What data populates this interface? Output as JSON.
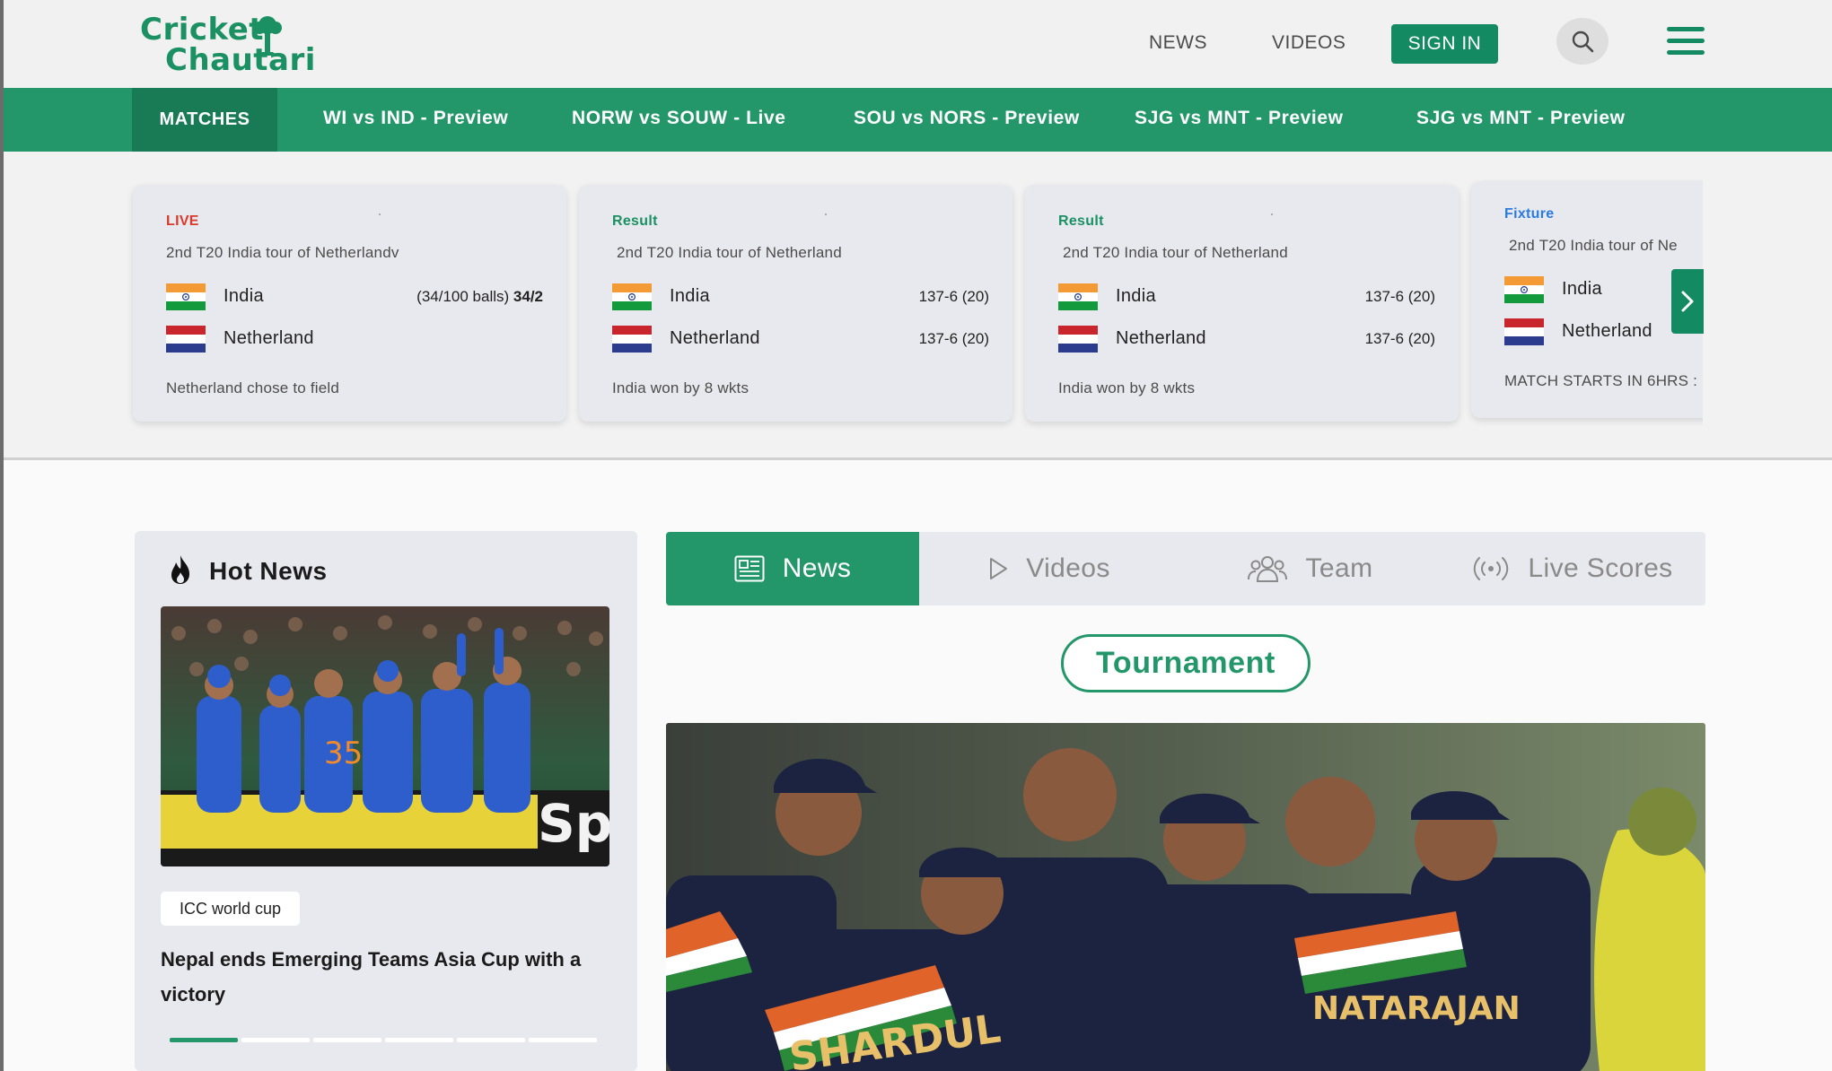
{
  "brand": {
    "logo_line1": "Cricket",
    "logo_line2": "Chautari",
    "accent_color": "#23976a",
    "accent_dark": "#138a61"
  },
  "header": {
    "nav": [
      {
        "label": "NEWS"
      },
      {
        "label": "VIDEOS"
      }
    ],
    "sign_in_label": "SIGN IN",
    "search_icon": "search-icon",
    "menu_icon": "hamburger-menu-icon"
  },
  "matches_bar": {
    "label": "MATCHES",
    "items": [
      {
        "label": "WI vs IND - Preview"
      },
      {
        "label": "NORW vs SOUW - Live"
      },
      {
        "label": "SOU vs NORS - Preview"
      },
      {
        "label": "SJG vs MNT - Preview"
      },
      {
        "label": "SJG vs MNT - Preview"
      }
    ]
  },
  "score_cards": [
    {
      "status": "LIVE",
      "status_color": "#d93a2b",
      "title": "2nd T20 India tour of Netherlandv",
      "teams": [
        {
          "name": "India",
          "flag": "india-flag",
          "score_prefix": "(34/100 balls) ",
          "score": "34/2"
        },
        {
          "name": "Netherland",
          "flag": "netherlands-flag",
          "score_prefix": "",
          "score": ""
        }
      ],
      "footer": "Netherland chose to field"
    },
    {
      "status": "Result",
      "status_color": "#1a9063",
      "title": "2nd T20 India tour of Netherland",
      "teams": [
        {
          "name": "India",
          "flag": "india-flag",
          "score_prefix": "",
          "score": "137-6 (20)"
        },
        {
          "name": "Netherland",
          "flag": "netherlands-flag",
          "score_prefix": "",
          "score": "137-6 (20)"
        }
      ],
      "footer": "India won by 8 wkts"
    },
    {
      "status": "Result",
      "status_color": "#1a9063",
      "title": "2nd T20 India tour of Netherland",
      "teams": [
        {
          "name": "India",
          "flag": "india-flag",
          "score_prefix": "",
          "score": "137-6 (20)"
        },
        {
          "name": "Netherland",
          "flag": "netherlands-flag",
          "score_prefix": "",
          "score": "137-6 (20)"
        }
      ],
      "footer": "India won by 8 wkts"
    },
    {
      "status": "Fixture",
      "status_color": "#2a7be0",
      "title": "2nd T20 India tour of Ne",
      "teams": [
        {
          "name": "India",
          "flag": "india-flag",
          "score_prefix": "",
          "score": ""
        },
        {
          "name": "Netherland",
          "flag": "netherlands-flag",
          "score_prefix": "",
          "score": ""
        }
      ],
      "footer": "MATCH STARTS IN 6HRS :"
    }
  ],
  "hot_news": {
    "title": "Hot News",
    "icon": "flame-icon",
    "image_alt": "Indian players celebrating on the field",
    "tag": "ICC world cup",
    "headline": "Nepal ends Emerging Teams Asia Cup with a victory",
    "slides_total": 6,
    "slide_active": 1
  },
  "tabs": [
    {
      "label": "News",
      "icon": "newspaper-icon",
      "active": true
    },
    {
      "label": "Videos",
      "icon": "play-icon",
      "active": false
    },
    {
      "label": "Team",
      "icon": "team-icon",
      "active": false
    },
    {
      "label": "Live Scores",
      "icon": "broadcast-icon",
      "active": false
    }
  ],
  "tournament_button": "Tournament",
  "main_image_alt": "Indian team huddling in navy jerseys"
}
